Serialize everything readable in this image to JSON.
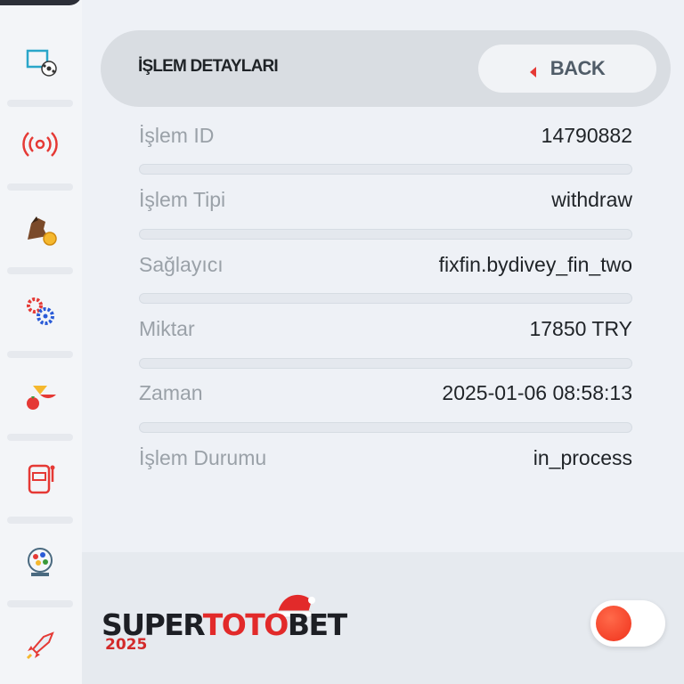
{
  "header": {
    "title": "İŞLEM DETAYLARI",
    "back_label": "BACK"
  },
  "details": [
    {
      "label": "İşlem ID",
      "value": "14790882"
    },
    {
      "label": "İşlem Tipi",
      "value": "withdraw"
    },
    {
      "label": "Sağlayıcı",
      "value": "fixfin.bydivey_fin_two"
    },
    {
      "label": "Miktar",
      "value": "17850 TRY"
    },
    {
      "label": "Zaman",
      "value": "2025-01-06 08:58:13"
    },
    {
      "label": "İşlem Durumu",
      "value": "in_process"
    }
  ],
  "sidebar": {
    "items": [
      {
        "icon": "sports-icon"
      },
      {
        "icon": "live-icon"
      },
      {
        "icon": "horse-racing-icon"
      },
      {
        "icon": "games-icon"
      },
      {
        "icon": "fruit-slots-icon"
      },
      {
        "icon": "slot-machine-icon"
      },
      {
        "icon": "lottery-icon"
      },
      {
        "icon": "rocket-icon"
      }
    ]
  },
  "logo": {
    "part1": "SUPER",
    "part2": "TOTO",
    "part3": "BET",
    "year": "2025"
  },
  "toggle": {
    "on": true
  },
  "colors": {
    "accent": "#e53935",
    "knob": "#f0321c",
    "panel": "#eef1f6"
  }
}
